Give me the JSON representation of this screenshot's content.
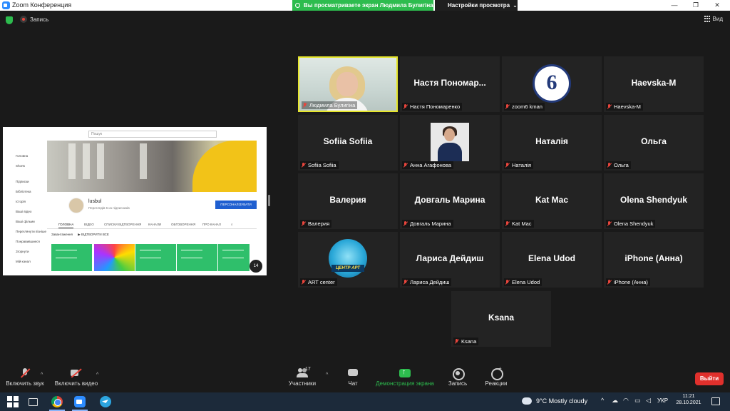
{
  "window": {
    "title": "Zoom Конференция",
    "share_banner": "Вы просматриваете экран Людмила Булигіна",
    "view_options": "Настройки просмотра",
    "minimize": "—",
    "maximize": "❐",
    "close": "✕"
  },
  "topbar": {
    "recording_label": "Запись",
    "view_label": "Вид"
  },
  "shared_screen": {
    "search_placeholder": "Пошук",
    "sidebar": [
      "Головна",
      "Shorts",
      "Підписки",
      "Бібліотека",
      "Історія",
      "Ваші відео",
      "Ваші фільми",
      "Переглянути пізніше",
      "Понравившиеся",
      "Згорнути",
      "Мій канал"
    ],
    "channel_name": "lusbul",
    "channel_subs": "Переглядів 6 из підписників",
    "subscribe": "ПЕРСОНАЛІЗУВАТИ КАНАЛ",
    "tabs": [
      "ГОЛОВНА",
      "ВІДЕО",
      "СПИСКИ ВІДТВОРЕННЯ",
      "КАНАЛИ",
      "ОБГОВОРЕННЯ",
      "ПРО КАНАЛ"
    ],
    "row_title": "Завантаження",
    "play_all": "▶ ВІДТВОРИТИ ВСЕ",
    "badge": "14"
  },
  "participants": [
    {
      "display": "",
      "label": "Людмила Булигіна",
      "type": "photo-woman",
      "active": true
    },
    {
      "display": "Настя Пономар...",
      "label": "Настя Пономаренко",
      "type": "name"
    },
    {
      "display": "",
      "label": "zoom6 kman",
      "type": "logo-six",
      "logo_text": "6"
    },
    {
      "display": "Haevska-M",
      "label": "Haevska-M",
      "type": "name"
    },
    {
      "display": "Sofiia Sofiia",
      "label": "Sofiia Sofiia",
      "type": "name"
    },
    {
      "display": "",
      "label": "Анна Агафонова",
      "type": "photo-anna"
    },
    {
      "display": "Наталія",
      "label": "Наталія",
      "type": "name"
    },
    {
      "display": "Ольга",
      "label": "Ольга",
      "type": "name"
    },
    {
      "display": "Валерия",
      "label": "Валерия",
      "type": "name"
    },
    {
      "display": "Довгаль Марина",
      "label": "Довгаль Марина",
      "type": "name"
    },
    {
      "display": "Kat Mac",
      "label": "Kat Mac",
      "type": "name"
    },
    {
      "display": "Olena Shendyuk",
      "label": "Olena Shendyuk",
      "type": "name"
    },
    {
      "display": "",
      "label": "ART center",
      "type": "art-logo",
      "logo_text": "ЦЕНТР АРТ"
    },
    {
      "display": "Лариса Дейдиш",
      "label": "Лариса Дейдиш",
      "type": "name"
    },
    {
      "display": "Elena Udod",
      "label": "Elena Udod",
      "type": "name"
    },
    {
      "display": "iPhone (Анна)",
      "label": "iPhone (Анна)",
      "type": "name"
    },
    {
      "display": "Ksana",
      "label": "Ksana",
      "type": "name"
    }
  ],
  "toolbar": {
    "mute": "Включить звук",
    "video": "Включить видео",
    "participants": "Участники",
    "participants_count": "17",
    "chat": "Чат",
    "share": "Демонстрация экрана",
    "record": "Запись",
    "reactions": "Реакции",
    "leave": "Выйти",
    "caret": "^"
  },
  "taskbar": {
    "weather": "9°C  Mostly cloudy",
    "tray_caret": "^",
    "language": "УКР",
    "time": "11:21",
    "date": "28.10.2021"
  }
}
